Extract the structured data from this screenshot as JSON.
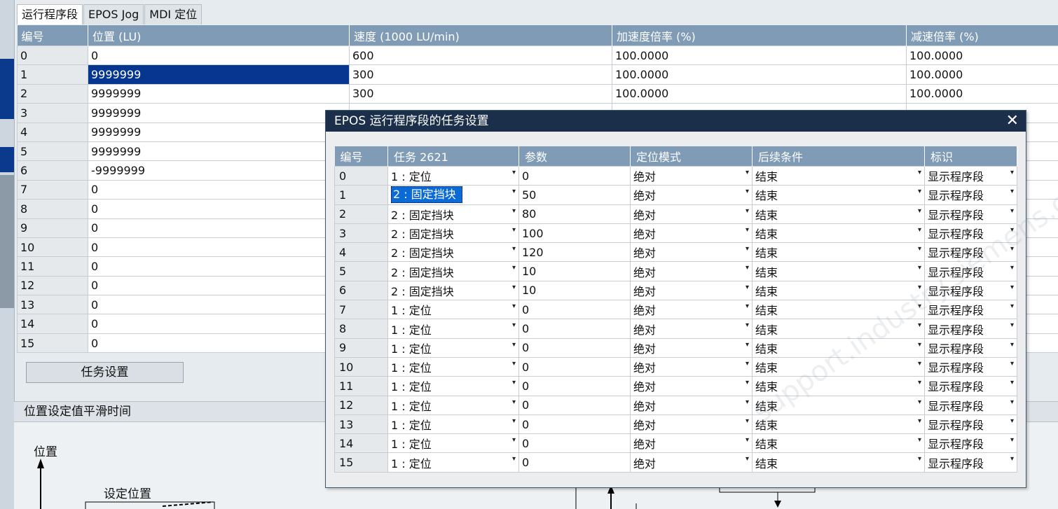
{
  "tabs": [
    {
      "label": "运行程序段",
      "active": true
    },
    {
      "label": "EPOS Jog",
      "active": false
    },
    {
      "label": "MDI 定位",
      "active": false
    }
  ],
  "main_table": {
    "headers": [
      "编号",
      "位置 (LU)",
      "速度 (1000 LU/min)",
      "加速度倍率 (%)",
      "减速倍率 (%)"
    ],
    "rows": [
      [
        "0",
        "0",
        "600",
        "100.0000",
        "100.0000"
      ],
      [
        "1",
        "9999999",
        "300",
        "100.0000",
        "100.0000"
      ],
      [
        "2",
        "9999999",
        "300",
        "100.0000",
        "100.0000"
      ],
      [
        "3",
        "9999999",
        "",
        "",
        ""
      ],
      [
        "4",
        "9999999",
        "",
        "",
        ""
      ],
      [
        "5",
        "9999999",
        "",
        "",
        ""
      ],
      [
        "6",
        "-9999999",
        "",
        "",
        ""
      ],
      [
        "7",
        "0",
        "",
        "",
        ""
      ],
      [
        "8",
        "0",
        "",
        "",
        ""
      ],
      [
        "9",
        "0",
        "",
        "",
        ""
      ],
      [
        "10",
        "0",
        "",
        "",
        ""
      ],
      [
        "11",
        "0",
        "",
        "",
        ""
      ],
      [
        "12",
        "0",
        "",
        "",
        ""
      ],
      [
        "13",
        "0",
        "",
        "",
        ""
      ],
      [
        "14",
        "0",
        "",
        "",
        ""
      ],
      [
        "15",
        "0",
        "",
        "",
        ""
      ]
    ],
    "selected_row": 1
  },
  "task_button_label": "任务设置",
  "section": {
    "title": "位置设定值平滑时间",
    "y_label": "位置",
    "setpoint_label": "设定位置"
  },
  "dialog": {
    "title": "EPOS 运行程序段的任务设置",
    "close_glyph": "✕",
    "dropdown_glyph": "▾",
    "headers": [
      "编号",
      "任务 2621",
      "参数",
      "定位模式",
      "后续条件",
      "标识"
    ],
    "rows": [
      [
        "0",
        "1 : 定位",
        "0",
        "绝对",
        "结束",
        "显示程序段"
      ],
      [
        "1",
        "2 : 固定挡块",
        "50",
        "绝对",
        "结束",
        "显示程序段"
      ],
      [
        "2",
        "2 : 固定挡块",
        "80",
        "绝对",
        "结束",
        "显示程序段"
      ],
      [
        "3",
        "2 : 固定挡块",
        "100",
        "绝对",
        "结束",
        "显示程序段"
      ],
      [
        "4",
        "2 : 固定挡块",
        "120",
        "绝对",
        "结束",
        "显示程序段"
      ],
      [
        "5",
        "2 : 固定挡块",
        "10",
        "绝对",
        "结束",
        "显示程序段"
      ],
      [
        "6",
        "2 : 固定挡块",
        "10",
        "绝对",
        "结束",
        "显示程序段"
      ],
      [
        "7",
        "1 : 定位",
        "0",
        "绝对",
        "结束",
        "显示程序段"
      ],
      [
        "8",
        "1 : 定位",
        "0",
        "绝对",
        "结束",
        "显示程序段"
      ],
      [
        "9",
        "1 : 定位",
        "0",
        "绝对",
        "结束",
        "显示程序段"
      ],
      [
        "10",
        "1 : 定位",
        "0",
        "绝对",
        "结束",
        "显示程序段"
      ],
      [
        "11",
        "1 : 定位",
        "0",
        "绝对",
        "结束",
        "显示程序段"
      ],
      [
        "12",
        "1 : 定位",
        "0",
        "绝对",
        "结束",
        "显示程序段"
      ],
      [
        "13",
        "1 : 定位",
        "0",
        "绝对",
        "结束",
        "显示程序段"
      ],
      [
        "14",
        "1 : 定位",
        "0",
        "绝对",
        "结束",
        "显示程序段"
      ],
      [
        "15",
        "1 : 定位",
        "0",
        "绝对",
        "结束",
        "显示程序段"
      ]
    ],
    "selected_row": 1
  },
  "watermark": "support.industry.siemens.com",
  "colors": {
    "header_bg": "#7f9bb5",
    "selection": "#06368f",
    "dialog_title_bg": "#1b2f4a",
    "focus_highlight": "#0a6ad6"
  }
}
